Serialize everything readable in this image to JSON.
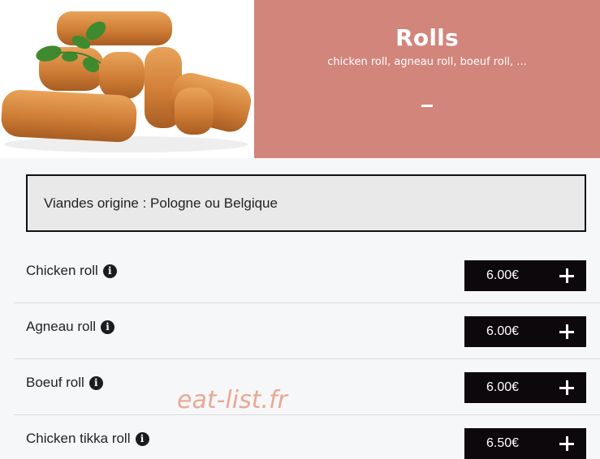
{
  "header": {
    "title": "Rolls",
    "subtitle": "chicken roll, agneau roll, boeuf roll, ...",
    "toggle_label": "–",
    "banner_color": "#d2857b",
    "photo_alt": "fried breaded rolls with parsley"
  },
  "notice": {
    "text": "Viandes origine : Pologne ou Belgique"
  },
  "items": [
    {
      "name": "Chicken roll",
      "price": "6.00€",
      "info_icon": "info-circle-icon",
      "add_icon": "plus-icon"
    },
    {
      "name": "Agneau roll",
      "price": "6.00€",
      "info_icon": "info-circle-icon",
      "add_icon": "plus-icon"
    },
    {
      "name": "Boeuf roll",
      "price": "6.00€",
      "info_icon": "info-circle-icon",
      "add_icon": "plus-icon"
    },
    {
      "name": "Chicken tikka roll",
      "price": "6.50€",
      "info_icon": "info-circle-icon",
      "add_icon": "plus-icon"
    }
  ],
  "watermark": {
    "text": "eat-list.fr"
  },
  "colors": {
    "page_background": "#f6f7f9",
    "price_button": "#0c080c",
    "notice_background": "#e9e9ea"
  }
}
